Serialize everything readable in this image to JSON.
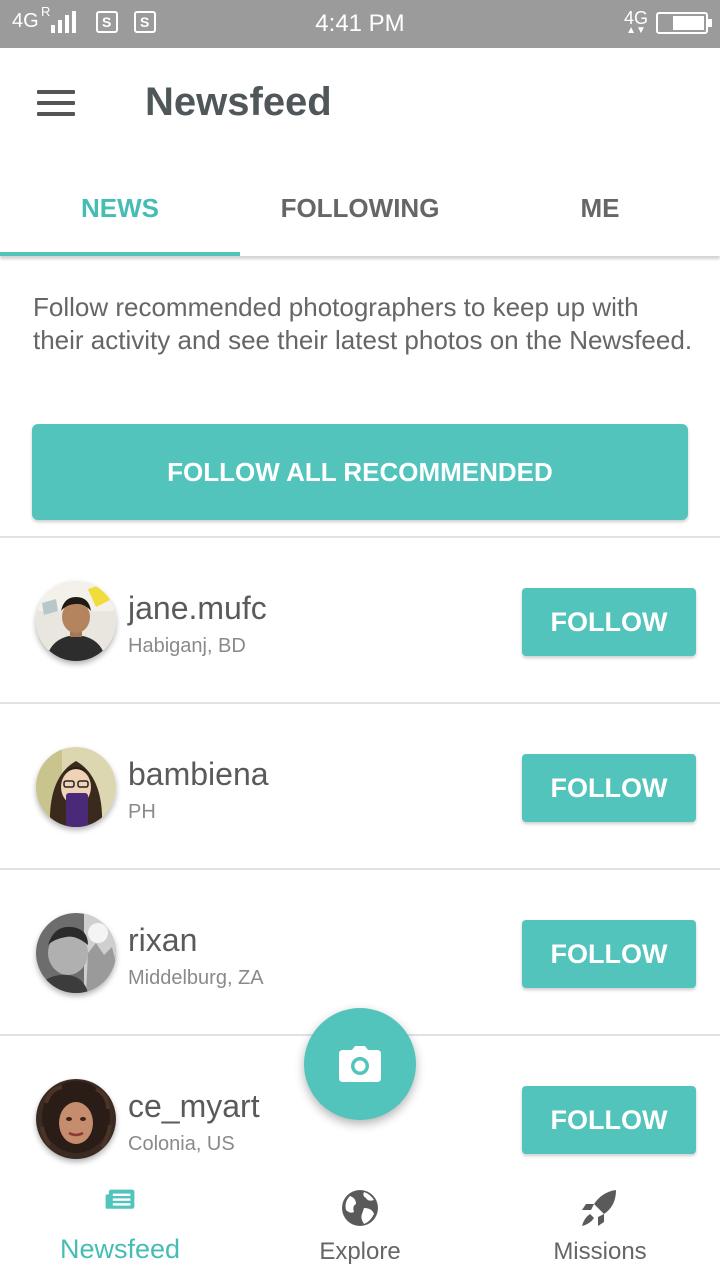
{
  "status_bar": {
    "network": "4G",
    "roaming": "R",
    "sim1": "S",
    "sim2": "S",
    "time": "4:41 PM",
    "data_network": "4G",
    "battery_level": 0.7
  },
  "app_bar": {
    "title": "Newsfeed",
    "menu_icon": "hamburger-menu-icon"
  },
  "tabs": [
    {
      "label": "NEWS",
      "active": true
    },
    {
      "label": "FOLLOWING",
      "active": false
    },
    {
      "label": "ME",
      "active": false
    }
  ],
  "intro": {
    "text": "Follow recommended photographers to keep up with their activity and see their latest photos on the Newsfeed.",
    "follow_all_label": "FOLLOW ALL RECOMMENDED"
  },
  "users": [
    {
      "username": "jane.mufc",
      "location": "Habiganj, BD",
      "button": "FOLLOW"
    },
    {
      "username": "bambiena",
      "location": "PH",
      "button": "FOLLOW"
    },
    {
      "username": "rixan",
      "location": "Middelburg, ZA",
      "button": "FOLLOW"
    },
    {
      "username": "ce_myart",
      "location": "Colonia, US",
      "button": "FOLLOW"
    }
  ],
  "fab": {
    "icon": "camera-icon"
  },
  "bottom_nav": [
    {
      "label": "Newsfeed",
      "icon": "newspaper-icon",
      "active": true
    },
    {
      "label": "Explore",
      "icon": "globe-icon",
      "active": false
    },
    {
      "label": "Missions",
      "icon": "rocket-icon",
      "active": false
    }
  ],
  "colors": {
    "accent": "#52c4bc",
    "accent_text": "#45bcb4",
    "status_bar": "#9b9b9b",
    "title_text": "#50575a"
  }
}
